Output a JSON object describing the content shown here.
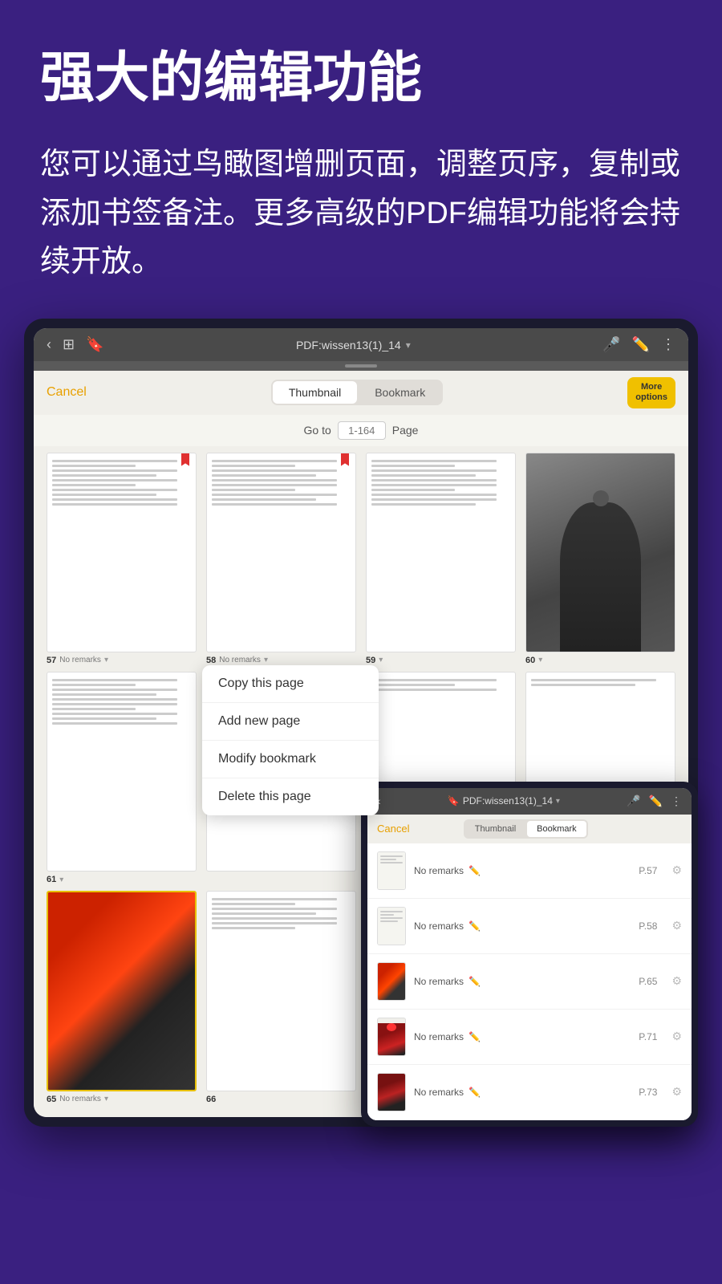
{
  "hero": {
    "title": "强大的编辑功能",
    "description": "您可以通过鸟瞰图增删页面，调整页序，复制或添加书签备注。更多高级的PDF编辑功能将会持续开放。"
  },
  "topbar": {
    "title": "PDF:wissen13(1)_14",
    "chevron": "▾"
  },
  "toolbar_drag": "",
  "action_bar": {
    "cancel": "Cancel",
    "tab_thumbnail": "Thumbnail",
    "tab_bookmark": "Bookmark",
    "more_options": "More\noptions"
  },
  "goto": {
    "label_before": "Go to",
    "placeholder": "1-164",
    "label_after": "Page"
  },
  "thumbnails": [
    {
      "num": "57",
      "remarks": "No remarks",
      "has_bookmark": true
    },
    {
      "num": "58",
      "remarks": "No remarks",
      "has_bookmark": true
    },
    {
      "num": "59",
      "remarks": "",
      "has_bookmark": false
    },
    {
      "num": "60",
      "remarks": "",
      "has_bookmark": false,
      "is_art": true
    },
    {
      "num": "61",
      "remarks": "",
      "has_bookmark": false
    },
    {
      "num": "",
      "remarks": "",
      "has_bookmark": false
    },
    {
      "num": "",
      "remarks": "",
      "has_bookmark": false
    },
    {
      "num": "",
      "remarks": "",
      "has_bookmark": false
    },
    {
      "num": "65",
      "remarks": "No remarks",
      "has_bookmark": false,
      "is_art": true,
      "is_highlighted": true
    },
    {
      "num": "66",
      "remarks": "",
      "has_bookmark": false
    }
  ],
  "context_menu": {
    "items": [
      "Copy this page",
      "Add new page",
      "Modify bookmark",
      "Delete this page"
    ]
  },
  "second_tablet": {
    "title": "PDF:wissen13(1)_14",
    "cancel": "Cancel",
    "tab_thumbnail": "Thumbnail",
    "tab_bookmark": "Bookmark"
  },
  "bookmark_list": [
    {
      "text": "No remarks",
      "page": "P.57",
      "has_art": false
    },
    {
      "text": "No remarks",
      "page": "P.58",
      "has_art": false
    },
    {
      "text": "No remarks",
      "page": "P.65",
      "has_art": true,
      "art_type": "figure"
    },
    {
      "text": "No remarks",
      "page": "P.71",
      "has_art": true,
      "art_type": "eye"
    },
    {
      "text": "No remarks",
      "page": "P.73",
      "has_art": true,
      "art_type": "eye2"
    }
  ]
}
